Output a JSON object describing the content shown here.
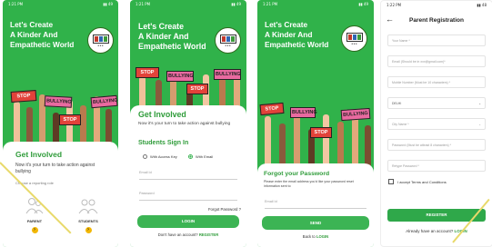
{
  "screen1": {
    "status_time": "1:21 PM",
    "status_icons": "▮▮ 49",
    "headline": [
      "Let's Create",
      "A Kinder And",
      "Empathetic World"
    ],
    "signs": [
      "STOP",
      "BULLYING",
      "STOP",
      "BULLYING"
    ],
    "card_title": "Get Involved",
    "card_text": "Now it's your turn to take action against bullying",
    "role_prompt": "Choose a reporting role",
    "roles": [
      "PARENT",
      "STUDENTS"
    ],
    "arrow": "›"
  },
  "screen2": {
    "status_time": "1:21 PM",
    "status_icons": "▮▮ 49",
    "headline": [
      "Let's Create",
      "A Kinder And",
      "Empathetic World"
    ],
    "signs": [
      "STOP",
      "BULLYING",
      "STOP",
      "BULLYING"
    ],
    "card_title": "Get Involved",
    "card_text": "Now it's your turn to take action against bullying",
    "signin_title": "Students Sign In",
    "option_access": "With Access Key",
    "option_email": "With Email",
    "email_placeholder": "Email Id",
    "password_placeholder": "Password",
    "forgot": "Forgot Password ?",
    "login": "LOGIN",
    "no_account": "Don't have an account?",
    "register_link": "REGISTER"
  },
  "screen3": {
    "status_time": "1:21 PM",
    "status_icons": "▮▮ 49",
    "headline": [
      "Let's Create",
      "A Kinder And",
      "Empathetic World"
    ],
    "signs": [
      "STOP",
      "BULLYING",
      "STOP",
      "BULLYING"
    ],
    "title": "Forgot your Password",
    "text": "Please enter the email address you'd like your password reset information sent to",
    "email_placeholder": "Email Id",
    "send": "SEND",
    "back": "Back to",
    "login_link": "LOGIN"
  },
  "screen4": {
    "status_time": "1:22 PM",
    "status_icons": "▮▮ 48",
    "back_arrow": "←",
    "title": "Parent Registration",
    "fields": [
      "Your Name *",
      "Email (Should be in xxx@gmail.com)*",
      "Mobile Number (Must be 10 characters) *",
      "DELHI",
      "City Name *",
      "Password (Must be atleast 8 characters) *",
      "Retype Password *"
    ],
    "dropdown_mark": "⌄",
    "terms": "I accept Terms and Conditions",
    "register": "REGISTER",
    "have_account": "Already have an account?",
    "login_link": "LOGIN"
  },
  "colors": {
    "brand_green": "#30b24a",
    "button_green": "#3cb454",
    "stop_red": "#e2423a",
    "bullying_pink": "#e96aa0"
  }
}
